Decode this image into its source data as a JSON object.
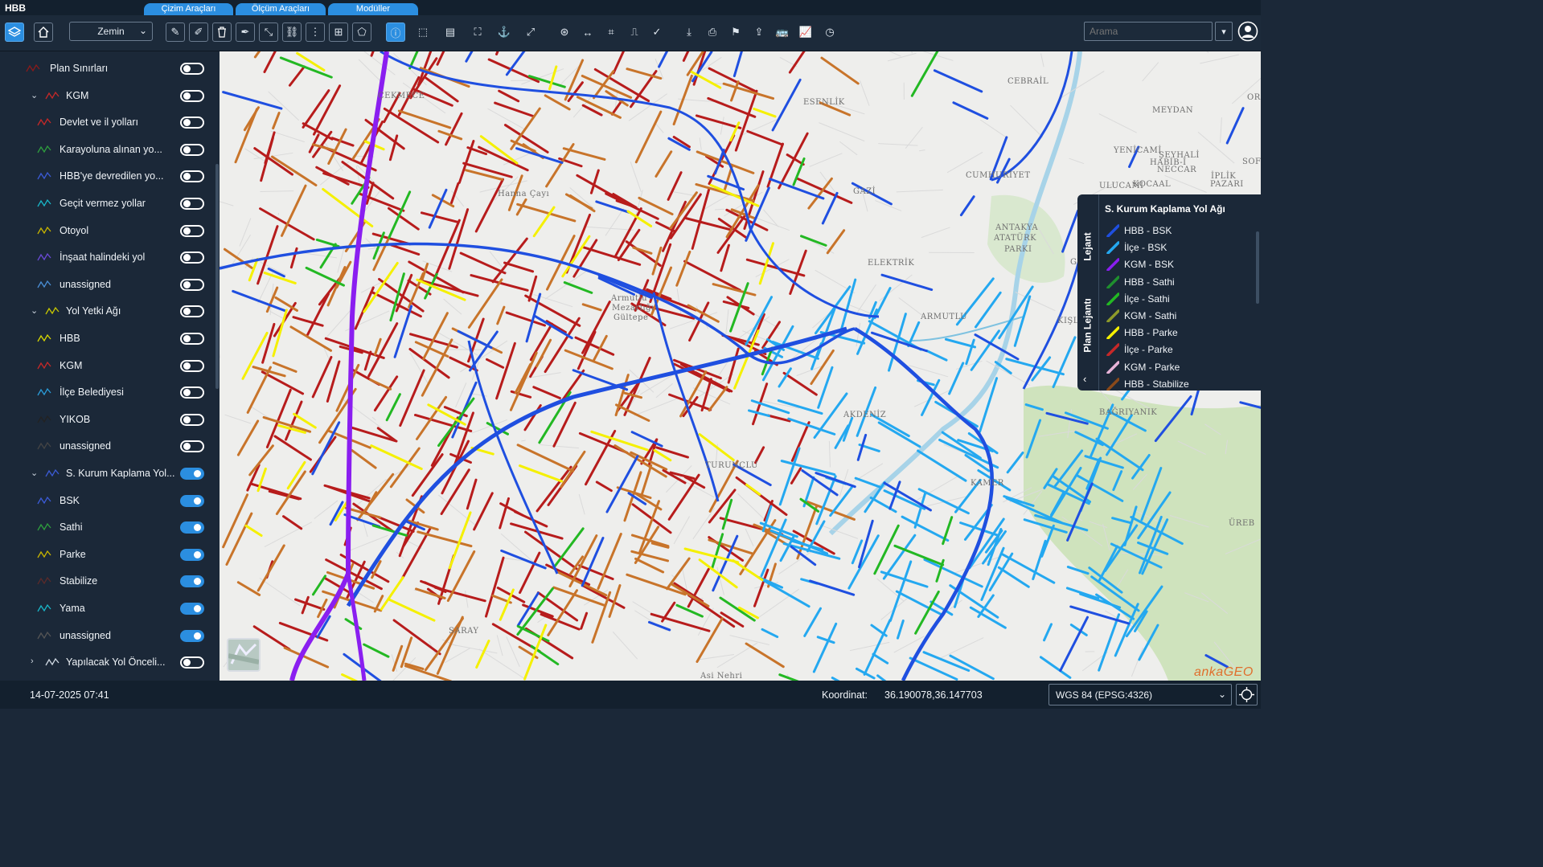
{
  "app": {
    "title": "HBB"
  },
  "top_tabs": [
    {
      "label": "Çizim Araçları"
    },
    {
      "label": "Ölçüm Araçları"
    },
    {
      "label": "Modüller"
    }
  ],
  "toolbar": {
    "basemap_select": "Zemin",
    "search_placeholder": "Arama",
    "tools": [
      "layers-icon",
      "home-icon",
      "draw-line-icon",
      "draw-edit-icon",
      "delete-icon",
      "draw-polygon-icon",
      "measure-icon",
      "link-icon",
      "split-icon",
      "add-layer-icon",
      "shape-icon",
      "info-icon",
      "select-icon",
      "table-icon",
      "fullscreen-icon",
      "anchor-icon",
      "extent-icon",
      "xy-icon",
      "distance-icon",
      "crop-icon",
      "stamp-icon",
      "check-icon",
      "download-icon",
      "print-icon",
      "flag-icon",
      "share-icon",
      "bus-icon",
      "chart-icon",
      "history-icon"
    ]
  },
  "sidebar": {
    "layers": [
      {
        "label": "Plan Sınırları",
        "icon_color": "#8b1a1a",
        "on": false,
        "level": 0,
        "expandable": false
      },
      {
        "label": "KGM",
        "icon_color": "#c62828",
        "on": false,
        "level": 0,
        "expandable": true
      },
      {
        "label": "Devlet ve il yolları",
        "icon_color": "#c62828",
        "on": false,
        "level": 1
      },
      {
        "label": "Karayoluna alınan yo...",
        "icon_color": "#2e9e3e",
        "on": false,
        "level": 1
      },
      {
        "label": "HBB'ye devredilen yo...",
        "icon_color": "#3b5bd6",
        "on": false,
        "level": 1
      },
      {
        "label": "Geçit vermez yollar",
        "icon_color": "#19b6c8",
        "on": false,
        "level": 1
      },
      {
        "label": "Otoyol",
        "icon_color": "#c8b400",
        "on": false,
        "level": 1
      },
      {
        "label": "İnşaat halindeki yol",
        "icon_color": "#6a4ad6",
        "on": false,
        "level": 1
      },
      {
        "label": "unassigned",
        "icon_color": "#4a8fd6",
        "on": false,
        "level": 1
      },
      {
        "label": "Yol Yetki Ağı",
        "icon_color": "#c8c800",
        "on": false,
        "level": 0,
        "expandable": true
      },
      {
        "label": "HBB",
        "icon_color": "#d8d800",
        "on": false,
        "level": 1
      },
      {
        "label": "KGM",
        "icon_color": "#c62828",
        "on": false,
        "level": 1
      },
      {
        "label": "İlçe Belediyesi",
        "icon_color": "#2a9bd8",
        "on": false,
        "level": 1
      },
      {
        "label": "YIKOB",
        "icon_color": "#222222",
        "on": false,
        "level": 1
      },
      {
        "label": "unassigned",
        "icon_color": "#444444",
        "on": false,
        "level": 1
      },
      {
        "label": "S. Kurum Kaplama Yol...",
        "icon_color": "#3b5bd6",
        "on": true,
        "level": 0,
        "expandable": true
      },
      {
        "label": "BSK",
        "icon_color": "#3b5bd6",
        "on": true,
        "level": 1
      },
      {
        "label": "Sathi",
        "icon_color": "#2e9e3e",
        "on": true,
        "level": 1
      },
      {
        "label": "Parke",
        "icon_color": "#c8b400",
        "on": true,
        "level": 1
      },
      {
        "label": "Stabilize",
        "icon_color": "#5a2a2a",
        "on": true,
        "level": 1
      },
      {
        "label": "Yama",
        "icon_color": "#19b6c8",
        "on": true,
        "level": 1
      },
      {
        "label": "unassigned",
        "icon_color": "#555555",
        "on": true,
        "level": 1
      },
      {
        "label": "Yapılacak Yol Önceli...",
        "icon_color": "#cfd8e2",
        "on": false,
        "level": 0,
        "expandable": true,
        "collapsed": true
      }
    ]
  },
  "map": {
    "labels": [
      "ÇEKMECE",
      "ESENLİK",
      "CEBRAİL",
      "MEYDAN",
      "YENİCAMİ",
      "ŞEYHALİ",
      "HABİB-İ",
      "NECCAR",
      "İPLİK",
      "PAZARI",
      "SOFU",
      "CUMHURİYET",
      "ULUCAMİ",
      "KOCAAL",
      "ORU",
      "GAZİ",
      "ANTAKYA",
      "ATATÜRK",
      "PARKI",
      "ELEKTRİK",
      "ARMUTLU",
      "KIŞLASA",
      "Hanna Çayı",
      "Armutlu",
      "Mezarlığı",
      "Gültepe",
      "AKDENİZ",
      "BAĞRIYANIK",
      "TURUNÇLU",
      "SARAY",
      "ÜREB",
      "Asi Nehri",
      "GÜ",
      "KAMER"
    ],
    "brand": "ankaGEO"
  },
  "legend": {
    "tabs": [
      "Lejant",
      "Plan Lejantı"
    ],
    "title": "S. Kurum Kaplama Yol Ağı",
    "items": [
      {
        "label": "HBB - BSK",
        "color": "#1f4fe0"
      },
      {
        "label": "İlçe - BSK",
        "color": "#24a8f0"
      },
      {
        "label": "KGM - BSK",
        "color": "#8a1ef0"
      },
      {
        "label": "HBB - Sathi",
        "color": "#1f8f2e"
      },
      {
        "label": "İlçe - Sathi",
        "color": "#23b823"
      },
      {
        "label": "KGM - Sathi",
        "color": "#8d9a2a"
      },
      {
        "label": "HBB - Parke",
        "color": "#f5f000"
      },
      {
        "label": "İlçe - Parke",
        "color": "#c62828"
      },
      {
        "label": "KGM - Parke",
        "color": "#e7b3d8"
      },
      {
        "label": "HBB - Stabilize",
        "color": "#8a4a1a"
      }
    ]
  },
  "status": {
    "datetime": "14-07-2025 07:41",
    "coord_label": "Koordinat:",
    "coord_value": "36.190078,36.147703",
    "crs": "WGS 84 (EPSG:4326)"
  }
}
